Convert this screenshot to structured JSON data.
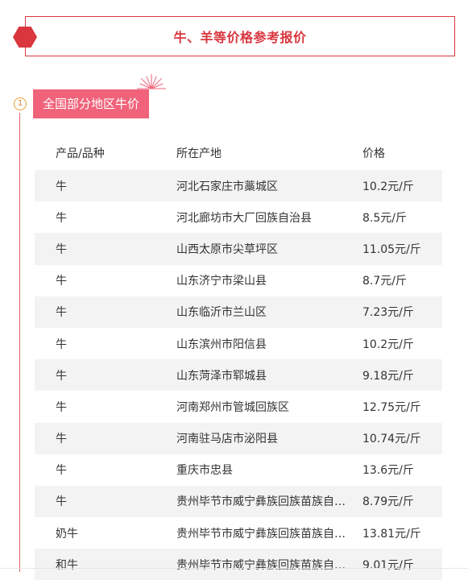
{
  "title": "牛、羊等价格参考报价",
  "section": {
    "number": "1",
    "label": "全国部分地区牛价"
  },
  "table": {
    "headers": [
      "产品/品种",
      "所在产地",
      "价格"
    ],
    "rows": [
      [
        "牛",
        "河北石家庄市藁城区",
        "10.2元/斤"
      ],
      [
        "牛",
        "河北廊坊市大厂回族自治县",
        "8.5元/斤"
      ],
      [
        "牛",
        "山西太原市尖草坪区",
        "11.05元/斤"
      ],
      [
        "牛",
        "山东济宁市梁山县",
        "8.7元/斤"
      ],
      [
        "牛",
        "山东临沂市兰山区",
        "7.23元/斤"
      ],
      [
        "牛",
        "山东滨州市阳信县",
        "10.2元/斤"
      ],
      [
        "牛",
        "山东菏泽市郓城县",
        "9.18元/斤"
      ],
      [
        "牛",
        "河南郑州市管城回族区",
        "12.75元/斤"
      ],
      [
        "牛",
        "河南驻马店市泌阳县",
        "10.74元/斤"
      ],
      [
        "牛",
        "重庆市忠县",
        "13.6元/斤"
      ],
      [
        "牛",
        "贵州毕节市威宁彝族回族苗族自…",
        "8.79元/斤"
      ],
      [
        "奶牛",
        "贵州毕节市威宁彝族回族苗族自…",
        "13.81元/斤"
      ],
      [
        "和牛",
        "贵州毕节市威宁彝族回族苗族自…",
        "9.01元/斤"
      ]
    ]
  },
  "colors": {
    "accent": "#d9363e",
    "label_bg": "#f0637a",
    "row_shade": "#f3f3f3"
  }
}
